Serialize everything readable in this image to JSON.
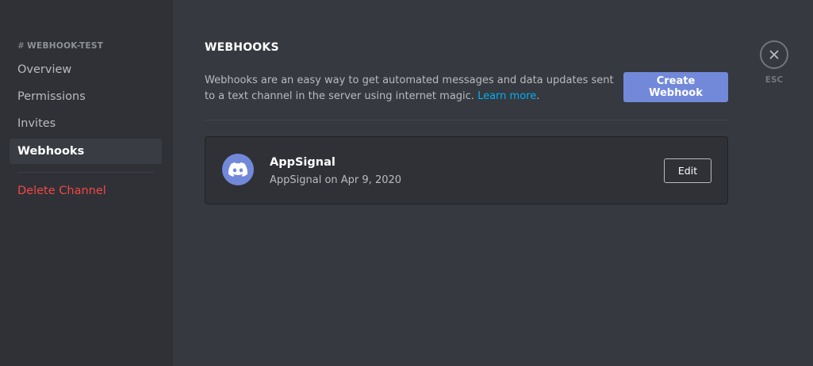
{
  "sidebar": {
    "channel_prefix": "#",
    "channel_name": "WEBHOOK-TEST",
    "items": [
      {
        "label": "Overview"
      },
      {
        "label": "Permissions"
      },
      {
        "label": "Invites"
      },
      {
        "label": "Webhooks",
        "active": true
      },
      {
        "label": "Delete Channel",
        "danger": true
      }
    ]
  },
  "main": {
    "title": "WEBHOOKS",
    "description": "Webhooks are an easy way to get automated messages and data updates sent to a text channel in the server using internet magic.",
    "learn_more": "Learn more",
    "description_end": ".",
    "create_button": "Create Webhook"
  },
  "webhook": {
    "name": "AppSignal",
    "meta": "AppSignal on Apr 9, 2020",
    "avatar_icon": "discord-icon",
    "edit_button": "Edit"
  },
  "close": {
    "icon": "close-icon",
    "label": "ESC"
  },
  "colors": {
    "accent": "#7289da",
    "danger": "#f04747",
    "link": "#00b0f4",
    "background": "#36393f",
    "sidebar": "#2f3136"
  }
}
